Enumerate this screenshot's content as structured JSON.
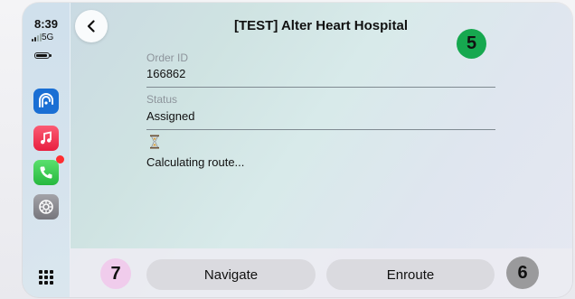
{
  "status_bar": {
    "time": "8:39",
    "network": "5G"
  },
  "header": {
    "title": "[TEST] Alter Heart Hospital"
  },
  "order": {
    "order_id_label": "Order ID",
    "order_id_value": "166862",
    "status_label": "Status",
    "status_value": "Assigned",
    "route_status": "Calculating route..."
  },
  "actions": {
    "navigate_label": "Navigate",
    "enroute_label": "Enroute"
  },
  "markers": {
    "top_right": "5",
    "bottom_left": "7",
    "bottom_right": "6"
  },
  "icons": {
    "back": "chevron-left-icon",
    "app_1": "connect-app-icon",
    "app_2": "music-app-icon",
    "app_3": "phone-app-icon",
    "app_4": "settings-app-icon",
    "grid": "app-grid-icon",
    "route": "hourglass-icon"
  },
  "colors": {
    "marker_top_right": "#16a84f",
    "marker_bottom_left": "#f0ccec",
    "marker_bottom_right": "#9a9a9c",
    "button_bg": "#dadadf",
    "notification": "#ff2d30"
  }
}
